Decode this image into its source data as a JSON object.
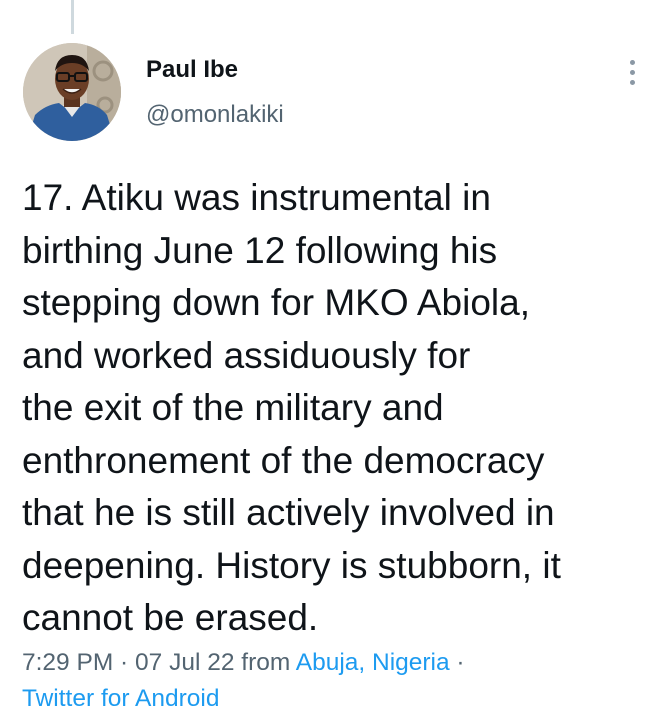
{
  "tweet": {
    "author": {
      "name": "Paul Ibe",
      "handle": "@omonlakiki"
    },
    "text_lines": [
      "17. Atiku was instrumental in",
      "birthing June 12 following his",
      "stepping down for MKO Abiola,",
      "and worked assiduously for",
      "the exit of the military and",
      "enthronement of the democracy",
      "that he is still actively involved in",
      "deepening. History is stubborn, it",
      "cannot be erased."
    ],
    "meta": {
      "time": "7:29 PM",
      "separator": " · ",
      "date": "07 Jul 22",
      "from_label": " from ",
      "location": "Abuja, Nigeria",
      "trailing_separator": " ·",
      "source": "Twitter for Android"
    }
  },
  "colors": {
    "text": "#0f1419",
    "secondary": "#536471",
    "link": "#1d9bf0",
    "thread_line": "#cfd9de"
  },
  "icons": {
    "more": "more-vertical-icon",
    "avatar": "profile-photo"
  }
}
